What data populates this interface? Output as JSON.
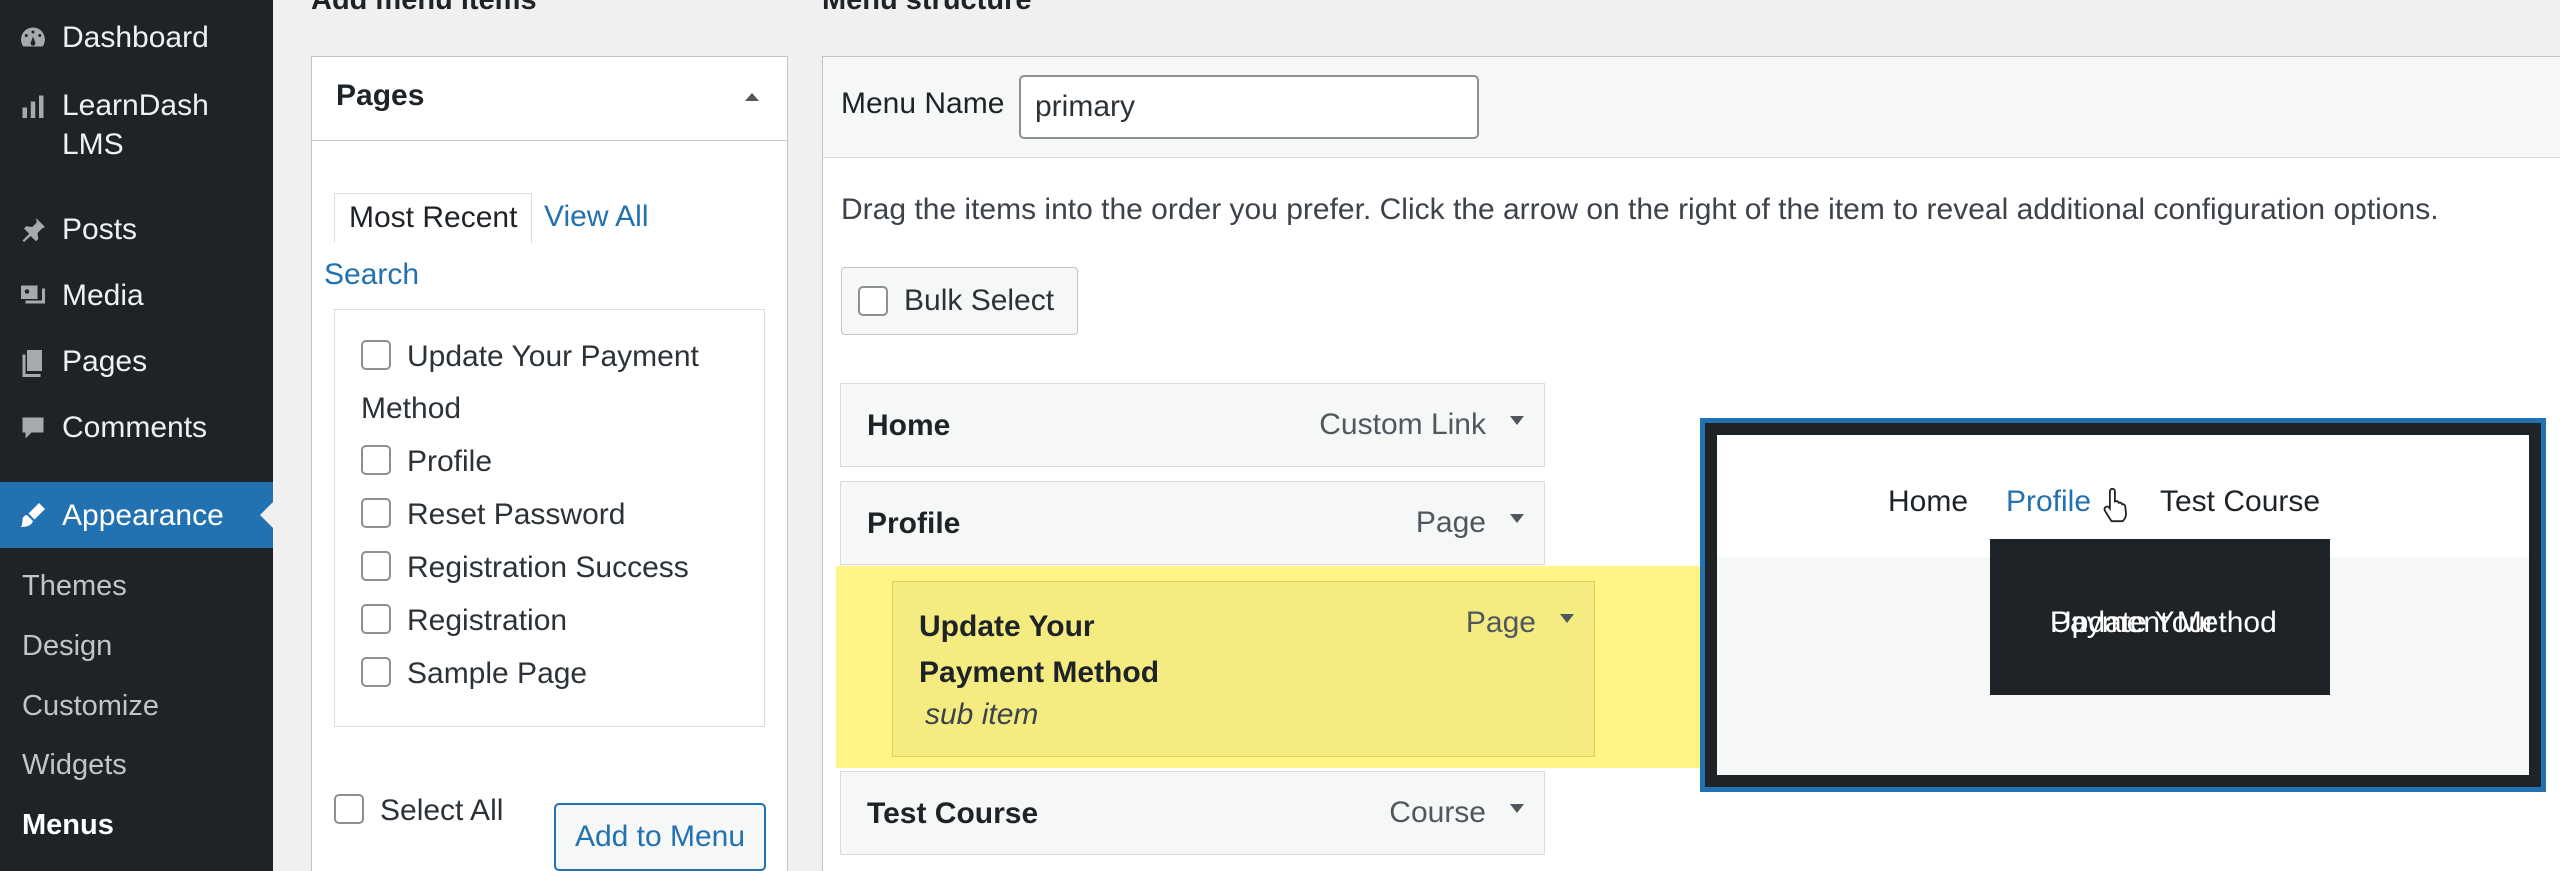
{
  "sidebar": {
    "items": [
      {
        "label": "Dashboard",
        "icon": "dashboard-icon"
      },
      {
        "label": "LearnDash",
        "label2": "LMS",
        "icon": "chart-bars-icon"
      },
      {
        "label": "Posts",
        "icon": "pin-icon"
      },
      {
        "label": "Media",
        "icon": "media-icon"
      },
      {
        "label": "Pages",
        "icon": "pages-icon"
      },
      {
        "label": "Comments",
        "icon": "comment-icon"
      },
      {
        "label": "Appearance",
        "icon": "paintbrush-icon"
      }
    ],
    "subitems": [
      "Themes",
      "Design",
      "Customize",
      "Widgets",
      "Menus"
    ],
    "active_color": "#2271b1"
  },
  "left_panel": {
    "section_title": "Add menu items",
    "box_title": "Pages",
    "tabs": {
      "recent": "Most Recent",
      "all": "View All",
      "search": "Search"
    },
    "pages": [
      "Update Your Payment",
      "Method",
      "Profile",
      "Reset Password",
      "Registration Success",
      "Registration",
      "Sample Page"
    ],
    "select_all": "Select All",
    "add_button": "Add to Menu"
  },
  "right_panel": {
    "section_title": "Menu structure",
    "menu_name_label": "Menu Name",
    "menu_name_value": "primary",
    "instructions": "Drag the items into the order you prefer. Click the arrow on the right of the item to reveal additional configuration options.",
    "bulk_select": "Bulk Select",
    "items": [
      {
        "title": "Home",
        "type": "Custom Link"
      },
      {
        "title": "Profile",
        "type": "Page"
      },
      {
        "title": "Update Your",
        "title2": "Payment Method",
        "type": "Page",
        "sub": "sub item"
      },
      {
        "title": "Test Course",
        "type": "Course"
      }
    ],
    "highlight_color": "#fff484"
  },
  "preview": {
    "links": [
      "Home",
      "Profile",
      "Test Course"
    ],
    "dropdown_line1": "Update Your",
    "dropdown_line2": "Payment Method"
  }
}
